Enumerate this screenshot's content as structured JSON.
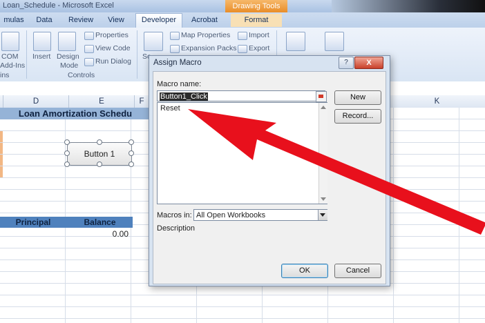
{
  "window": {
    "title": "Loan_Schedule - Microsoft Excel",
    "context_tab": "Drawing Tools"
  },
  "ribbon": {
    "tabs": [
      "mulas",
      "Data",
      "Review",
      "View",
      "Developer",
      "Acrobat",
      "Format"
    ],
    "active_tab": "Developer",
    "groups": {
      "addins_labels": [
        "COM",
        "Add-Ins",
        "ins"
      ],
      "controls": {
        "insert": "Insert",
        "design": "Design",
        "mode": "Mode",
        "properties": "Properties",
        "view_code": "View Code",
        "run_dialog": "Run Dialog",
        "group_label": "Controls"
      },
      "xml": {
        "source": "So",
        "map_properties": "Map Properties",
        "expansion_packs": "Expansion Packs",
        "import": "Import",
        "export": "Export"
      }
    }
  },
  "sheet": {
    "columns": [
      "D",
      "E",
      "F",
      "K"
    ],
    "title": "Loan Amortization Schedu",
    "headers": [
      "Principal",
      "Balance"
    ],
    "balance_value": "0.00",
    "button_label": "Button 1"
  },
  "dialog": {
    "title": "Assign Macro",
    "help_label": "?",
    "close_label": "X",
    "macro_name_label": "Macro name:",
    "macro_name_value": "Button1_Click",
    "list_items": [
      "Reset"
    ],
    "new_label": "New",
    "record_label": "Record...",
    "macros_in_label": "Macros in:",
    "macros_in_value": "All Open Workbooks",
    "description_label": "Description",
    "ok_label": "OK",
    "cancel_label": "Cancel"
  },
  "colors": {
    "annotation_arrow": "#e8101c",
    "title_band": "#95b3d7",
    "header_band": "#4f81bd"
  }
}
